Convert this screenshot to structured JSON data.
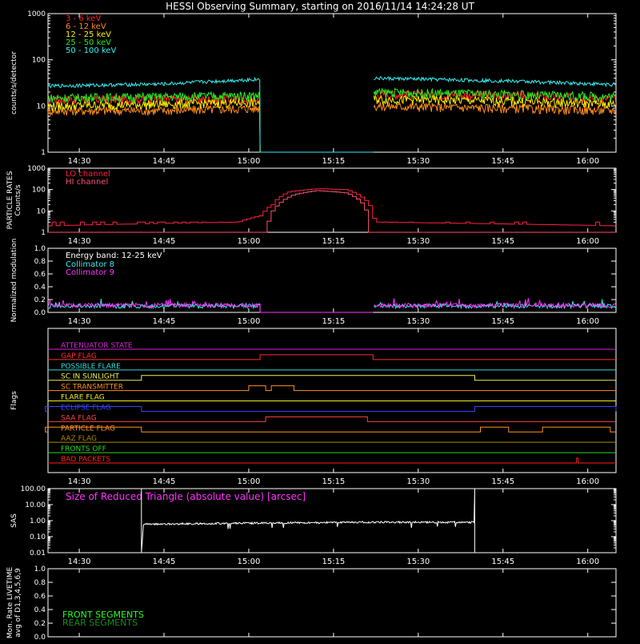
{
  "title": "HESSI Observing Summary, starting on 2016/11/14 14:24:28 UT",
  "time_axis": {
    "start": "14:24:28",
    "end": "16:05:00",
    "ticks": [
      "14:30",
      "14:45",
      "15:00",
      "15:15",
      "15:30",
      "15:45",
      "16:00"
    ]
  },
  "colors": {
    "background": "#000000",
    "axis": "#ffffff",
    "e3_6": "#ff2020",
    "e6_12": "#ff8c1a",
    "e12_25": "#ffee00",
    "e25_50": "#22ee22",
    "e50_100": "#33eeee",
    "lo_channel": "#ff2040",
    "hi_channel": "#ff5070",
    "col8": "#33eeee",
    "col9": "#ff33ff",
    "front_segments": "#22ff22",
    "rear_segments": "#1a8a1a",
    "sas": "#ffffff"
  },
  "chart_data": [
    {
      "id": "count-rates",
      "type": "line",
      "ylabel": "counts/s/detector",
      "yscale": "log",
      "ylim": [
        1,
        1000
      ],
      "yticks": [
        "1",
        "10",
        "100",
        "1000"
      ],
      "data_gap": [
        "15:02",
        "15:22"
      ],
      "series": [
        {
          "name": "3 - 6 keV",
          "color_key": "e3_6",
          "x": [
            "14:24",
            "14:45",
            "15:02",
            "15:22",
            "15:45",
            "16:05"
          ],
          "y": [
            14,
            14,
            14,
            18,
            17,
            14
          ]
        },
        {
          "name": "6 - 12 keV",
          "color_key": "e6_12",
          "x": [
            "14:24",
            "14:45",
            "15:02",
            "15:22",
            "15:45",
            "16:05"
          ],
          "y": [
            8,
            8,
            9,
            10,
            9,
            8
          ]
        },
        {
          "name": "12 - 25 keV",
          "color_key": "e12_25",
          "x": [
            "14:24",
            "14:45",
            "15:02",
            "15:22",
            "15:45",
            "16:05"
          ],
          "y": [
            10,
            11,
            12,
            14,
            13,
            11
          ]
        },
        {
          "name": "25 - 50 keV",
          "color_key": "e25_50",
          "x": [
            "14:24",
            "14:45",
            "15:02",
            "15:22",
            "15:45",
            "16:05"
          ],
          "y": [
            15,
            16,
            17,
            20,
            18,
            16
          ]
        },
        {
          "name": "50 - 100 keV",
          "color_key": "e50_100",
          "x": [
            "14:24",
            "14:45",
            "15:02",
            "15:22",
            "15:45",
            "16:05"
          ],
          "y": [
            27,
            30,
            38,
            40,
            35,
            29
          ]
        }
      ]
    },
    {
      "id": "particle-rates",
      "type": "line",
      "ylabel": "PARTICLE RATES Counts/s",
      "yscale": "log",
      "ylim": [
        1,
        1000
      ],
      "yticks": [
        "1",
        "10",
        "100",
        "1000"
      ],
      "series": [
        {
          "name": "LO channel",
          "color_key": "lo_channel",
          "x": [
            "14:24",
            "14:58",
            "15:02",
            "15:04",
            "15:07",
            "15:12",
            "15:17",
            "15:20",
            "15:22",
            "16:05"
          ],
          "y": [
            2,
            3,
            6,
            20,
            80,
            110,
            100,
            40,
            3,
            2
          ]
        },
        {
          "name": "HI channel",
          "color_key": "hi_channel",
          "x": [
            "14:24",
            "15:03",
            "15:05",
            "15:08",
            "15:12",
            "15:17",
            "15:20",
            "15:21",
            "16:05"
          ],
          "y": [
            1,
            1,
            20,
            60,
            90,
            70,
            20,
            1,
            1
          ]
        }
      ]
    },
    {
      "id": "modulation",
      "type": "line",
      "ylabel": "Normalized modulation",
      "ylim": [
        0,
        1
      ],
      "yticks": [
        "0.0",
        "0.2",
        "0.4",
        "0.6",
        "0.8",
        "1.0"
      ],
      "annotation": "Energy band: 12-25 keV",
      "data_gap": [
        "15:02",
        "15:22"
      ],
      "series": [
        {
          "name": "Collimator 8",
          "color_key": "col8",
          "x": [
            "14:24",
            "15:02",
            "15:22",
            "16:05"
          ],
          "y": [
            0.1,
            0.1,
            0.1,
            0.1
          ]
        },
        {
          "name": "Collimator 9",
          "color_key": "col9",
          "x": [
            "14:24",
            "15:02",
            "15:22",
            "16:05"
          ],
          "y": [
            0.11,
            0.11,
            0.11,
            0.11
          ]
        }
      ]
    },
    {
      "id": "flags",
      "type": "line",
      "ylabel": "Flags",
      "series": [
        {
          "name": "ATTENUATOR STATE",
          "color": "#dd22dd",
          "steps": []
        },
        {
          "name": "GAP FLAG",
          "color": "#ff3030",
          "steps": [
            [
              "15:02",
              "15:22"
            ]
          ]
        },
        {
          "name": "POSSIBLE FLARE",
          "color": "#33dddd",
          "steps": []
        },
        {
          "name": "SC IN SUNLIGHT",
          "color": "#eeee55",
          "steps": [
            [
              "14:41",
              "15:40"
            ]
          ]
        },
        {
          "name": "SC TRANSMITTER",
          "color": "#ff8c1a",
          "steps": [
            [
              "15:00",
              "15:03"
            ],
            [
              "15:04",
              "15:08"
            ]
          ]
        },
        {
          "name": "FLARE FLAG",
          "color": "#eeee22",
          "steps": []
        },
        {
          "name": "ECLIPSE FLAG",
          "color": "#3344ff",
          "steps": [
            [
              "14:24",
              "14:41"
            ],
            [
              "15:40",
              "16:05"
            ]
          ]
        },
        {
          "name": "SAA FLAG",
          "color": "#ff4040",
          "steps": [
            [
              "15:03",
              "15:21"
            ]
          ]
        },
        {
          "name": "PARTICLE FLAG",
          "color": "#ff9020",
          "steps": [
            [
              "14:24",
              "14:41"
            ],
            [
              "15:41",
              "15:46"
            ],
            [
              "15:52",
              "16:04"
            ]
          ]
        },
        {
          "name": "AAZ FLAG",
          "color": "#aa8800",
          "steps": []
        },
        {
          "name": "FRONTS OFF",
          "color": "#22dd22",
          "steps": []
        },
        {
          "name": "BAD PACKETS",
          "color": "#ff2020",
          "steps": [
            [
              "15:58",
              "15:58"
            ]
          ]
        }
      ]
    },
    {
      "id": "sas",
      "type": "line",
      "ylabel": "SAS",
      "yscale": "log",
      "ylim": [
        0.01,
        100
      ],
      "yticks": [
        "0.01",
        "0.10",
        "1.00",
        "10.00",
        "100.00"
      ],
      "annotation": "Size of Reduced Triangle (absolute value) [arcsec]",
      "series": [
        {
          "name": "SAS",
          "color_key": "sas",
          "x": [
            "14:41",
            "14:42",
            "15:00",
            "15:20",
            "15:40"
          ],
          "y": [
            100,
            0.6,
            0.7,
            0.8,
            0.8
          ]
        }
      ]
    },
    {
      "id": "livetime",
      "type": "line",
      "ylabel": "Mon. Rate LIVETIME avg of D1,3,4,5,6,9",
      "ylim": [
        0,
        1
      ],
      "yticks": [
        "0.0",
        "0.2",
        "0.4",
        "0.6",
        "0.8",
        "1.0"
      ],
      "series": [
        {
          "name": "FRONT SEGMENTS",
          "color_key": "front_segments",
          "x": [],
          "y": []
        },
        {
          "name": "REAR SEGMENTS",
          "color_key": "rear_segments",
          "x": [],
          "y": []
        }
      ]
    }
  ]
}
